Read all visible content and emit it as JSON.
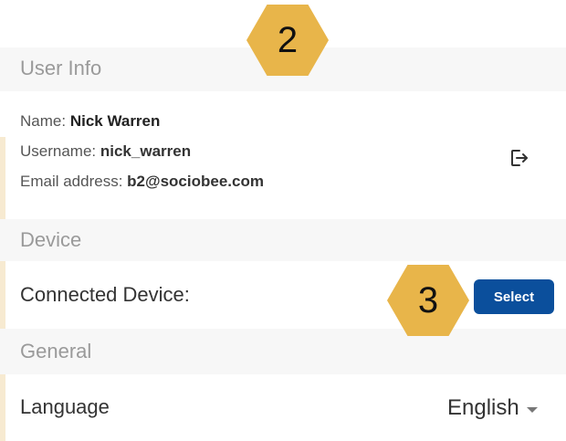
{
  "sections": {
    "user_info": "User Info",
    "device": "Device",
    "general": "General"
  },
  "user": {
    "name_label": "Name:",
    "name_value": "Nick Warren",
    "username_label": "Username:",
    "username_value": "nick_warren",
    "email_label": "Email address:",
    "email_value": "b2@sociobee.com"
  },
  "device": {
    "label": "Connected Device:",
    "button": "Select"
  },
  "general": {
    "language_label": "Language",
    "language_value": "English"
  },
  "markers": {
    "m2": "2",
    "m3": "3"
  },
  "icons": {
    "logout": "logout-icon",
    "dropdown": "chevron-down-icon"
  },
  "colors": {
    "accent": "#0b4f9c",
    "marker": "#e8b54a"
  }
}
